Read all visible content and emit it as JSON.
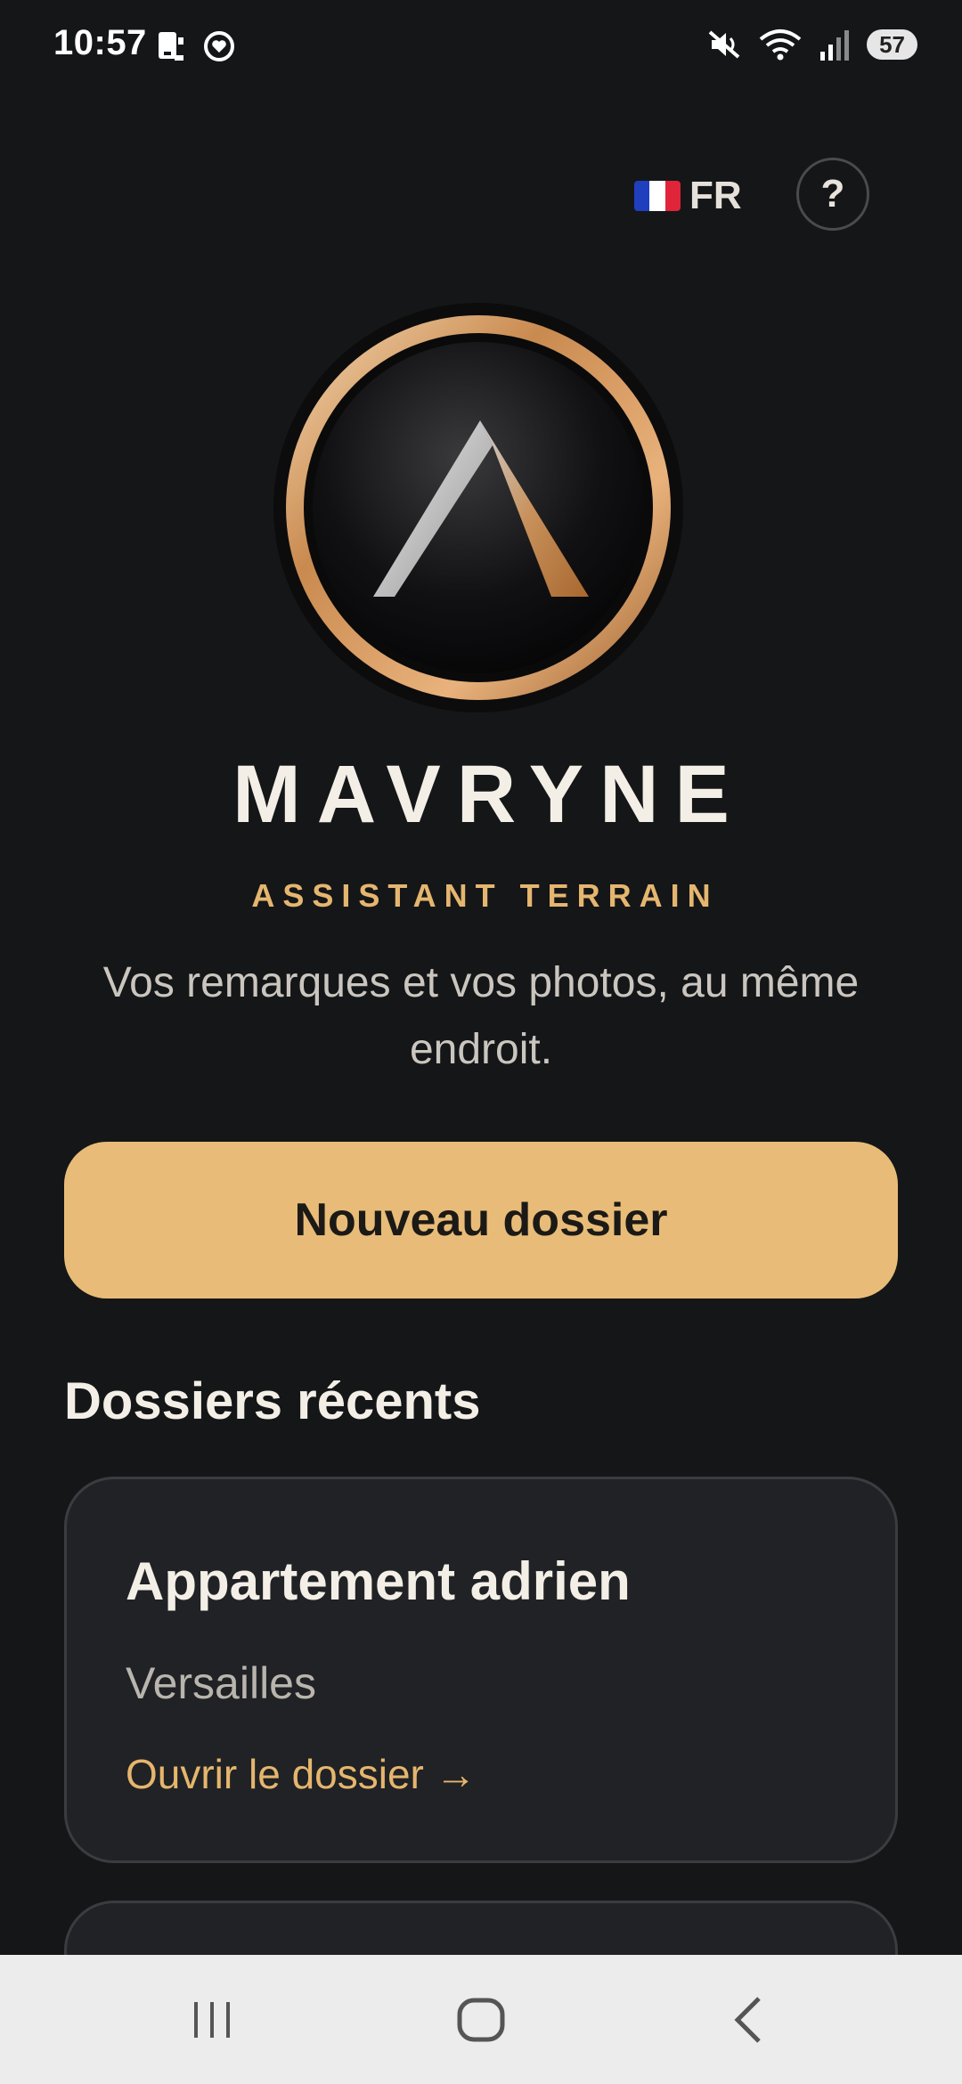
{
  "status_bar": {
    "time": "10:57",
    "battery": "57"
  },
  "header": {
    "language_code": "FR",
    "help_label": "?",
    "flag_colors": [
      "#1f3fbf",
      "#ffffff",
      "#e0243a"
    ]
  },
  "brand": {
    "name": "MAVRYNE",
    "subtitle": "ASSISTANT TERRAIN",
    "tagline": "Vos remarques et vos photos, au même endroit."
  },
  "actions": {
    "new_folder_label": "Nouveau dossier"
  },
  "recent": {
    "title": "Dossiers récents",
    "folders": [
      {
        "name": "Appartement adrien",
        "location": "Versailles",
        "open_label": "Ouvrir le dossier →"
      }
    ]
  },
  "colors": {
    "accent": "#e8bc78",
    "background": "#151618",
    "card": "#202225"
  }
}
